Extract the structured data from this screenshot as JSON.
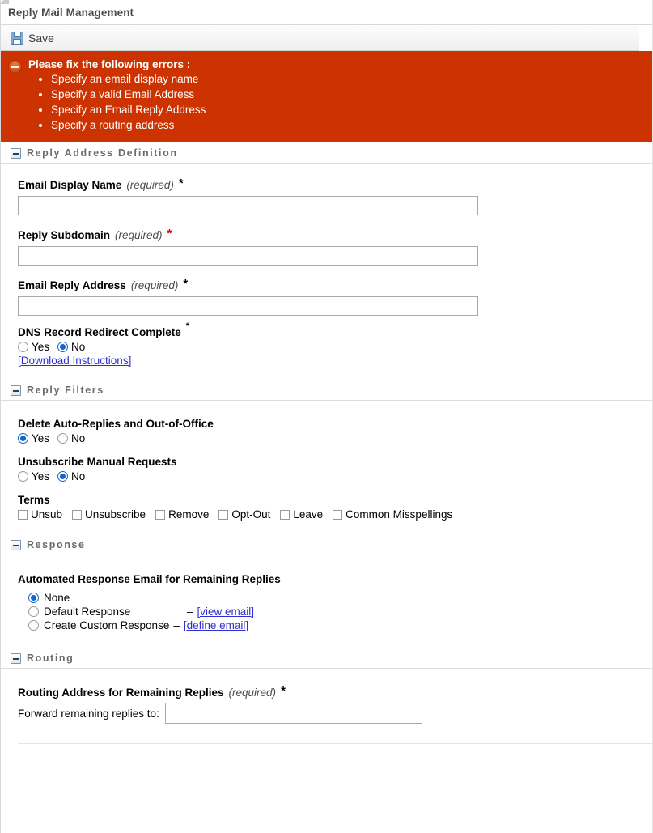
{
  "window": {
    "title": "Reply Mail Management"
  },
  "toolbar": {
    "save_label": "Save",
    "save_icon": "floppy-disk-icon"
  },
  "error_banner": {
    "icon": "error-minus-circle-icon",
    "bg_color": "#cc3300",
    "title": "Please fix the following errors :",
    "messages": [
      "Specify an email display name",
      "Specify a valid Email Address",
      "Specify an Email Reply Address",
      "Specify a routing address"
    ]
  },
  "sections": {
    "reply_address_definition": {
      "title": "Reply Address Definition",
      "collapse_icon": "collapse-minus-icon",
      "fields": {
        "email_display_name": {
          "label": "Email Display Name",
          "required_note": "(required)",
          "asterisk": "*",
          "asterisk_color": "#000000",
          "value": "",
          "placeholder": ""
        },
        "reply_subdomain": {
          "label": "Reply Subdomain",
          "required_note": "(required)",
          "asterisk": "*",
          "asterisk_color": "#e00000",
          "value": "",
          "placeholder": ""
        },
        "email_reply_address": {
          "label": "Email Reply Address",
          "required_note": "(required)",
          "asterisk": "*",
          "asterisk_color": "#000000",
          "value": "",
          "placeholder": ""
        },
        "dns_record": {
          "label": "DNS Record Redirect Complete",
          "asterisk": "*",
          "options": [
            "Yes",
            "No"
          ],
          "selected": "No",
          "link_label": "[Download Instructions]"
        }
      }
    },
    "reply_filters": {
      "title": "Reply Filters",
      "collapse_icon": "collapse-minus-icon",
      "delete_auto_replies": {
        "label": "Delete Auto-Replies and Out-of-Office",
        "options": [
          "Yes",
          "No"
        ],
        "selected": "Yes"
      },
      "unsubscribe_manual": {
        "label": "Unsubscribe Manual Requests",
        "options": [
          "Yes",
          "No"
        ],
        "selected": "No"
      },
      "terms": {
        "label": "Terms",
        "items": [
          {
            "label": "Unsub",
            "checked": false
          },
          {
            "label": "Unsubscribe",
            "checked": false
          },
          {
            "label": "Remove",
            "checked": false
          },
          {
            "label": "Opt-Out",
            "checked": false
          },
          {
            "label": "Leave",
            "checked": false
          },
          {
            "label": "Common Misspellings",
            "checked": false
          }
        ]
      }
    },
    "response": {
      "title": "Response",
      "collapse_icon": "collapse-minus-icon",
      "group_label": "Automated Response Email for Remaining Replies",
      "options": [
        {
          "label": "None",
          "selected": true,
          "dash": "",
          "link": ""
        },
        {
          "label": "Default Response",
          "selected": false,
          "dash": "–",
          "link": "[view email]"
        },
        {
          "label": "Create Custom Response",
          "selected": false,
          "dash": "–",
          "link": "[define email]"
        }
      ]
    },
    "routing": {
      "title": "Routing",
      "collapse_icon": "collapse-minus-icon",
      "label": "Routing Address for Remaining Replies",
      "required_note": "(required)",
      "asterisk": "*",
      "field_label": "Forward remaining replies to:",
      "value": "",
      "placeholder": ""
    }
  }
}
